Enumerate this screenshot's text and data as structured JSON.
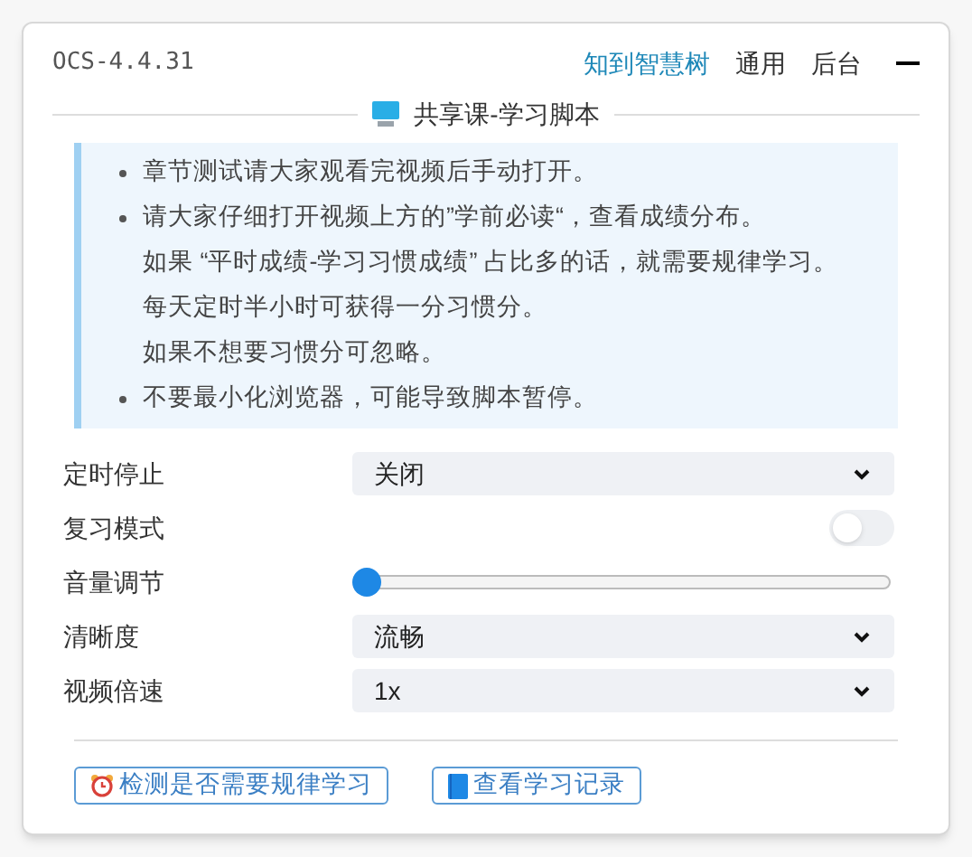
{
  "header": {
    "version": "OCS-4.4.31",
    "tabs": [
      {
        "label": "知到智慧树",
        "selected": true
      },
      {
        "label": "通用",
        "selected": false
      },
      {
        "label": "后台",
        "selected": false
      }
    ]
  },
  "section_title": "共享课-学习脚本",
  "notice": [
    {
      "kind": "bullet",
      "text": "章节测试请大家观看完视频后手动打开。"
    },
    {
      "kind": "bullet",
      "text": "请大家仔细打开视频上方的”学前必读“，查看成绩分布。"
    },
    {
      "kind": "line",
      "text": "如果 “平时成绩-学习习惯成绩” 占比多的话，就需要规律学习。"
    },
    {
      "kind": "line",
      "text": "每天定时半小时可获得一分习惯分。"
    },
    {
      "kind": "line",
      "text": "如果不想要习惯分可忽略。"
    },
    {
      "kind": "bullet",
      "text": "不要最小化浏览器，可能导致脚本暂停。"
    }
  ],
  "settings": [
    {
      "kind": "select",
      "label": "定时停止",
      "value": "关闭"
    },
    {
      "kind": "switch",
      "label": "复习模式",
      "on": false
    },
    {
      "kind": "slider",
      "label": "音量调节",
      "level": 0
    },
    {
      "kind": "select",
      "label": "清晰度",
      "value": "流畅"
    },
    {
      "kind": "select",
      "label": "视频倍速",
      "value": "1x"
    }
  ],
  "buttons": [
    {
      "kind": "alarm",
      "label": "检测是否需要规律学习"
    },
    {
      "kind": "book",
      "label": "查看学习记录"
    }
  ]
}
